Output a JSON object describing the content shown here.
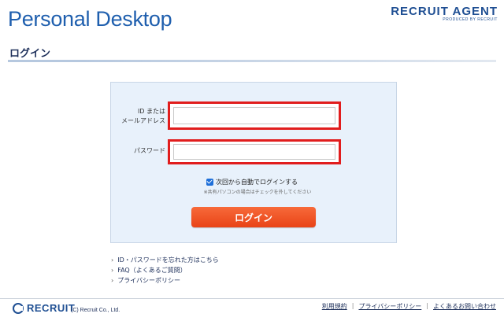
{
  "header": {
    "brand_title": "Personal Desktop",
    "agent_logo_main": "RECRUIT AGENT",
    "agent_logo_sub": "PRODUCED BY RECRUIT"
  },
  "section": {
    "title": "ログイン"
  },
  "form": {
    "id_label_line1": "ID または",
    "id_label_line2": "メールアドレス",
    "id_value": "",
    "password_label": "パスワード",
    "password_value": "",
    "remember_label": "次回から自動でログインする",
    "remember_checked": true,
    "remember_note": "※共有パソコンの場合はチェックを外してください",
    "login_button": "ログイン"
  },
  "links": [
    {
      "label": "ID・パスワードを忘れた方はこちら"
    },
    {
      "label": "FAQ（よくあるご質問）"
    },
    {
      "label": "プライバシーポリシー"
    }
  ],
  "footer": {
    "logo_word": "RECRUIT",
    "copyright": "(C) Recruit Co., Ltd.",
    "links": [
      "利用規約",
      "プライバシーポリシー",
      "よくあるお問い合わせ"
    ]
  },
  "colors": {
    "brand_blue": "#1f5fae",
    "highlight_red": "#e11d1d",
    "button_orange": "#e94316",
    "panel_bg": "#e8f1fb"
  }
}
